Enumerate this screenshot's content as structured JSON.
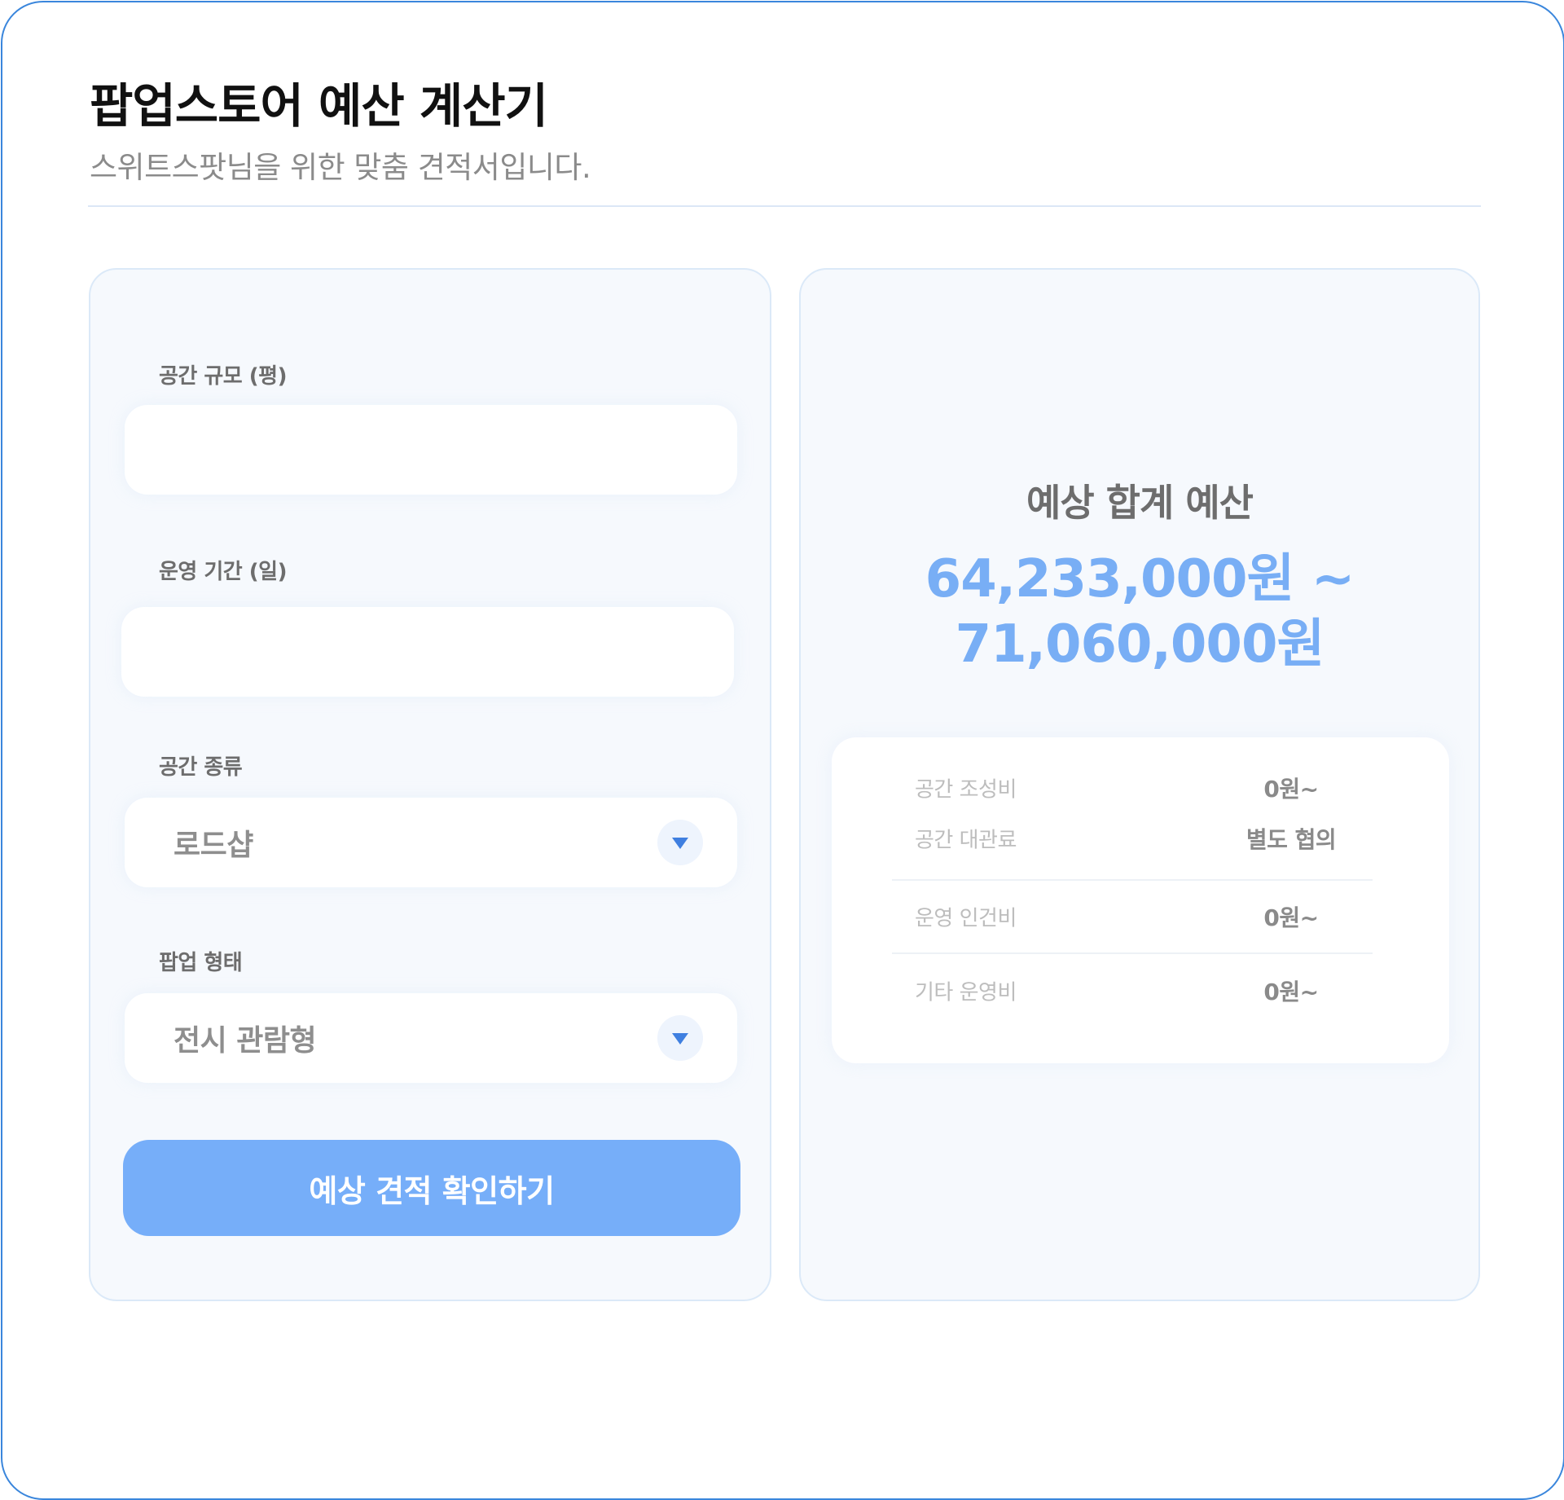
{
  "header": {
    "title": "팝업스토어 예산 계산기",
    "subtitle": "스위트스팟님을 위한 맞춤 견적서입니다."
  },
  "form": {
    "fields": [
      {
        "label": "공간 규모 (평)",
        "value": "",
        "placeholder": ""
      },
      {
        "label": "운영 기간 (일)",
        "value": "",
        "placeholder": ""
      }
    ],
    "selects": [
      {
        "label": "공간 종류",
        "selected": "로드샵",
        "icon": "chevron-down-icon"
      },
      {
        "label": "팝업 형태",
        "selected": "전시 관람형",
        "icon": "chevron-down-icon"
      }
    ],
    "submit_label": "예상 견적 확인하기"
  },
  "result": {
    "title": "예상 합계 예산",
    "amount_line1": "64,233,000원 ~",
    "amount_line2": "71,060,000원",
    "breakdown": [
      {
        "label": "공간 조성비",
        "value": "0원~"
      },
      {
        "label": "공간 대관료",
        "value": "별도 협의"
      },
      {
        "label": "운영 인건비",
        "value": "0원~"
      },
      {
        "label": "기타 운영비",
        "value": "0원~"
      }
    ]
  },
  "colors": {
    "accent": "#76aef9",
    "amount": "#78aef5",
    "panel_bg": "#f6f9fd",
    "frame_border": "#3a86dc"
  }
}
